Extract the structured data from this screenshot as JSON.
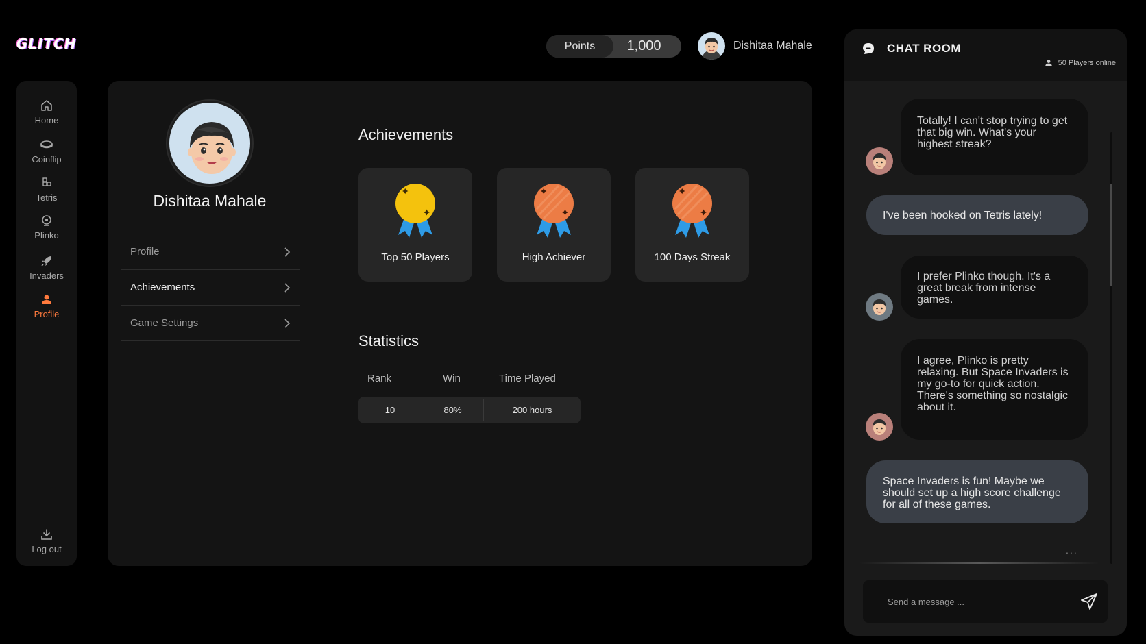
{
  "app": {
    "logo": "GLITCH"
  },
  "topbar": {
    "points_label": "Points",
    "points_value": "1,000",
    "user_name": "Dishitaa Mahale"
  },
  "sidebar": {
    "items": [
      {
        "label": "Home",
        "icon": "home-icon"
      },
      {
        "label": "Coinflip",
        "icon": "coin-icon"
      },
      {
        "label": "Tetris",
        "icon": "tetris-icon"
      },
      {
        "label": "Plinko",
        "icon": "plinko-icon"
      },
      {
        "label": "Invaders",
        "icon": "rocket-icon"
      },
      {
        "label": "Profile",
        "icon": "user-icon",
        "active": true
      }
    ],
    "logout_label": "Log out"
  },
  "profile": {
    "name": "Dishitaa Mahale",
    "menu": [
      {
        "label": "Profile"
      },
      {
        "label": "Achievements",
        "active": true
      },
      {
        "label": "Game Settings"
      }
    ]
  },
  "achievements": {
    "title": "Achievements",
    "badges": [
      {
        "label": "Top 50 Players",
        "medal": "gold"
      },
      {
        "label": "High Achiever",
        "medal": "bronze"
      },
      {
        "label": "100 Days Streak",
        "medal": "bronze"
      }
    ]
  },
  "statistics": {
    "title": "Statistics",
    "headers": [
      "Rank",
      "Win",
      "Time Played"
    ],
    "values": [
      "10",
      "80%",
      "200 hours"
    ]
  },
  "chat": {
    "title": "CHAT ROOM",
    "online": "50 Players online",
    "messages": [
      {
        "from": "other",
        "text": "Totally! I can't stop trying to get that big win. What's your highest streak?"
      },
      {
        "from": "me",
        "text": "I've been hooked on Tetris lately!"
      },
      {
        "from": "other",
        "text": "I prefer Plinko though. It's a great break from intense games."
      },
      {
        "from": "other",
        "text": "I agree, Plinko is pretty relaxing. But Space Invaders is my go-to for quick action. There's something so nostalgic about it."
      },
      {
        "from": "me",
        "text": "Space Invaders is fun! Maybe we should set up a high score challenge for all of these games."
      }
    ],
    "typing": "...",
    "input_placeholder": "Send a message ..."
  },
  "colors": {
    "accent": "#ff7a3d",
    "badge_bg": "#262626",
    "my_bubble": "#3a3f47",
    "ribbon": "#2e9be6",
    "gold": "#f4c20d",
    "bronze": "#ec7c45"
  }
}
